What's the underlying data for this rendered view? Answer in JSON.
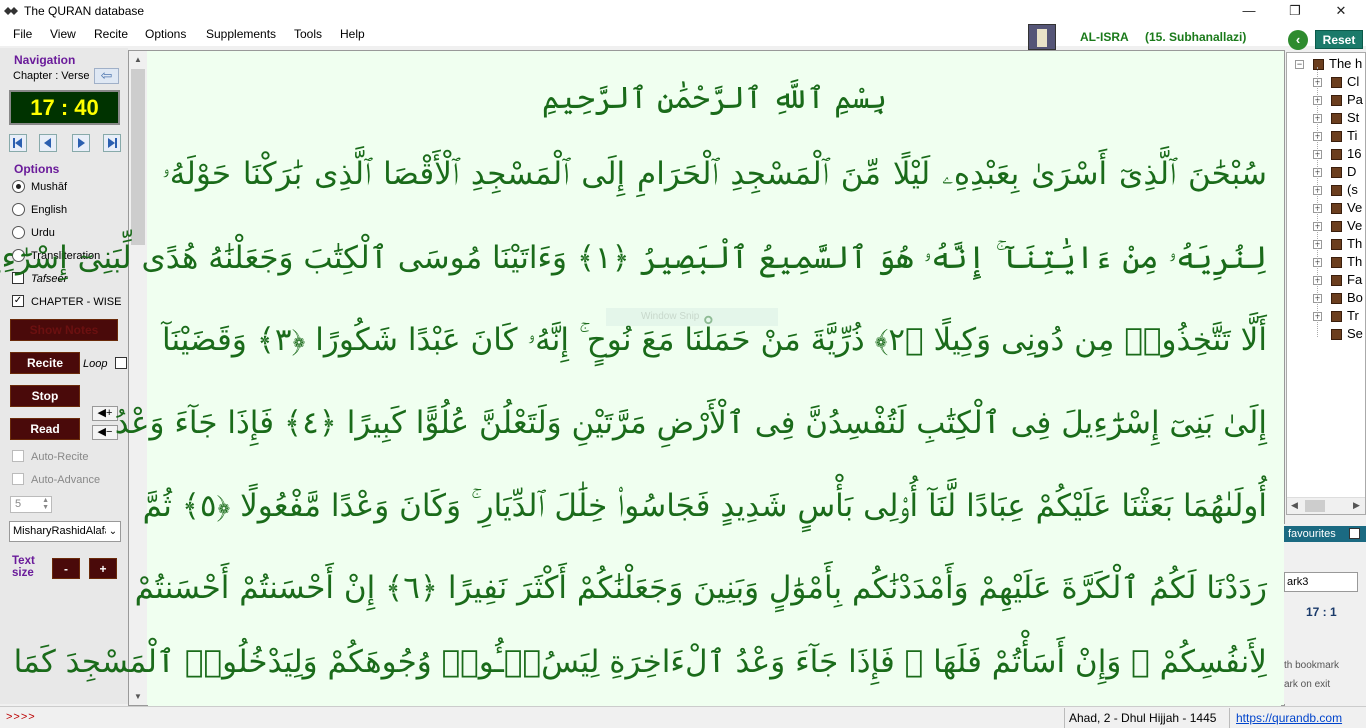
{
  "window": {
    "title": "The QURAN database",
    "min": "—",
    "max": "❐",
    "close": "✕"
  },
  "menu": [
    "File",
    "View",
    "Recite",
    "Options",
    "Supplements",
    "Tools",
    "Help"
  ],
  "header": {
    "surah_name": "AL-ISRA",
    "surah_number": "(15. Subhanallazi)",
    "reset_label": "Reset"
  },
  "nav": {
    "title": "Navigation",
    "chapter_verse_label": "Chapter : Verse",
    "current": "17 : 40"
  },
  "options": {
    "title": "Options",
    "items": [
      {
        "label": "Mushāf",
        "type": "radio",
        "checked": true
      },
      {
        "label": "English",
        "type": "radio",
        "checked": false
      },
      {
        "label": "Urdu",
        "type": "radio",
        "checked": false
      },
      {
        "label": "Transliteration",
        "type": "radio",
        "checked": false
      },
      {
        "label": "Tafseer",
        "type": "check",
        "checked": false
      },
      {
        "label": "CHAPTER - WISE",
        "type": "check",
        "checked": true
      }
    ]
  },
  "controls": {
    "show_button": "Show Notes",
    "recite": "Recite",
    "loop": "Loop",
    "stop": "Stop",
    "read": "Read",
    "auto_recite": "Auto-Recite",
    "auto_advance": "Auto-Advance",
    "interval": "5",
    "reciter": "MisharyRashidAlafasy",
    "text_size": "Text size",
    "minus": "-",
    "plus": "+"
  },
  "quran": {
    "bismillah": "بِسْمِ ٱللَّهِ ٱلرَّحْمَٰنِ ٱلرَّحِيمِ",
    "lines": [
      "سُبْحَٰنَ ٱلَّذِىٓ أَسْرَىٰ بِعَبْدِهِۦ لَيْلًا مِّنَ ٱلْمَسْجِدِ ٱلْحَرَامِ إِلَى ٱلْمَسْجِدِ ٱلْأَقْصَا ٱلَّذِى بَٰرَكْنَا حَوْلَهُۥ",
      "لِنُرِيَهُۥ مِنْ ءَايَٰتِنَآ ۚ إِنَّهُۥ هُوَ ٱلسَّمِيعُ ٱلْبَصِيرُ ﴿١﴾ وَءَاتَيْنَا مُوسَى ٱلْكِتَٰبَ وَجَعَلْنَٰهُ هُدًى لِّبَنِىٓ إِسْرَٰٓءِيلَ",
      "أَلَّا تَتَّخِذُوا۟ مِن دُونِى وَكِيلًا ﴿٢﴾ ذُرِّيَّةَ مَنْ حَمَلْنَا مَعَ نُوحٍ ۚ إِنَّهُۥ كَانَ عَبْدًا شَكُورًا ﴿٣﴾ وَقَضَيْنَآ",
      "إِلَىٰ بَنِىٓ إِسْرَٰٓءِيلَ فِى ٱلْكِتَٰبِ لَتُفْسِدُنَّ فِى ٱلْأَرْضِ مَرَّتَيْنِ وَلَتَعْلُنَّ عُلُوًّا كَبِيرًا ﴿٤﴾ فَإِذَا جَآءَ وَعْدُ",
      "أُولَىٰهُمَا بَعَثْنَا عَلَيْكُمْ عِبَادًا لَّنَآ أُو۟لِى بَأْسٍ شَدِيدٍ فَجَاسُوا۟ خِلَٰلَ ٱلدِّيَارِ ۚ وَكَانَ وَعْدًا مَّفْعُولًا ﴿٥﴾ ثُمَّ",
      "رَدَدْنَا لَكُمُ ٱلْكَرَّةَ عَلَيْهِمْ وَأَمْدَدْنَٰكُم بِأَمْوَٰلٍ وَبَنِينَ وَجَعَلْنَٰكُمْ أَكْثَرَ نَفِيرًا ﴿٦﴾ إِنْ أَحْسَنتُمْ أَحْسَنتُمْ",
      "لِأَنفُسِكُمْ ۖ وَإِنْ أَسَأْتُمْ فَلَهَا ۚ فَإِذَا جَآءَ وَعْدُ ٱلْءَاخِرَةِ لِيَسُۥٓـُٔوا۟ وُجُوهَكُمْ وَلِيَدْخُلُوا۟ ٱلْمَسْجِدَ كَمَا"
    ],
    "overlay_hint": "Window Snip"
  },
  "tree": {
    "items": [
      "The h",
      "Cl",
      "Pa",
      "St",
      "Ti",
      "16",
      "D",
      "(s",
      "Ve",
      "Ve",
      "Th",
      "Th",
      "Fa",
      "Bo",
      "Tr",
      "Se"
    ]
  },
  "rightpanel": {
    "favourites": "favourites",
    "bookmark_value": "ark3",
    "bookmark_pos": "17 : 1",
    "note1": "th bookmark",
    "note2": "ark on exit"
  },
  "status": {
    "arrows": ">>>>",
    "date": "Ahad,  2 - Dhul Hijjah - 1445",
    "link": "https://qurandb.com"
  },
  "colors": {
    "green_text": "#1a6b1a",
    "page_bg": "#f0fff0",
    "digital_bg": "#003300",
    "digital_fg": "#ffff00"
  }
}
